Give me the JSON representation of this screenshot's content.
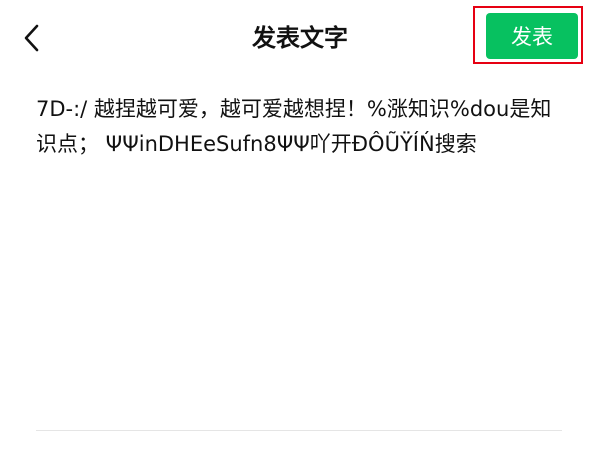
{
  "header": {
    "back_icon": "chevron-left-icon",
    "title": "发表文字",
    "publish_label": "发表"
  },
  "editor": {
    "text": "7D-:/ 越捏越可爱，越可爱越想捏！%涨知识%dou是知识点； ΨΨinDHEeSufn8ΨΨ吖开ĐÔŨŸÍŃ搜索"
  },
  "colors": {
    "publish_bg": "#07c160",
    "publish_text": "#ffffff",
    "highlight_border": "#e60012",
    "title_text": "#111111",
    "body_text": "#111111"
  }
}
